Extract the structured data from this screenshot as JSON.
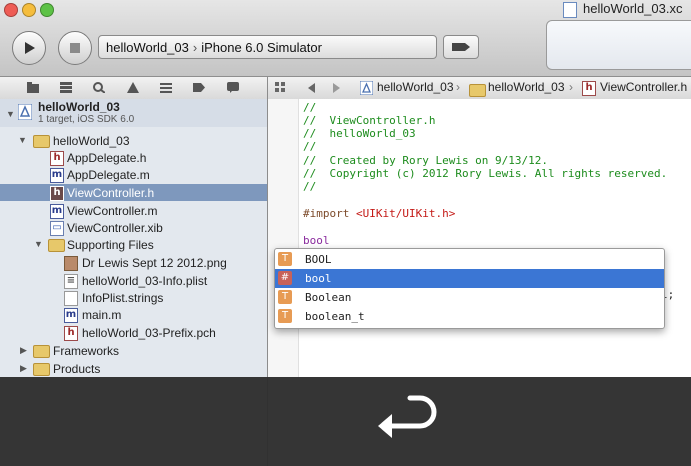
{
  "window": {
    "title": "helloWorld_03.xc"
  },
  "toolbar": {
    "scheme_project": "helloWorld_03",
    "scheme_separator": "›",
    "scheme_destination": "iPhone 6.0 Simulator"
  },
  "project": {
    "name": "helloWorld_03",
    "subtitle": "1 target, iOS SDK 6.0"
  },
  "navigator": {
    "items": [
      {
        "label": "helloWorld_03"
      },
      {
        "label": "AppDelegate.h"
      },
      {
        "label": "AppDelegate.m"
      },
      {
        "label": "ViewController.h"
      },
      {
        "label": "ViewController.m"
      },
      {
        "label": "ViewController.xib"
      },
      {
        "label": "Supporting Files"
      },
      {
        "label": "Dr Lewis Sept 12 2012.png"
      },
      {
        "label": "helloWorld_03-Info.plist"
      },
      {
        "label": "InfoPlist.strings"
      },
      {
        "label": "main.m"
      },
      {
        "label": "helloWorld_03-Prefix.pch"
      },
      {
        "label": "Frameworks"
      },
      {
        "label": "Products"
      }
    ]
  },
  "jump_bar": {
    "crumb1": "helloWorld_03",
    "crumb2": "helloWorld_03",
    "crumb3": "ViewController.h"
  },
  "editor": {
    "lines": [
      "//",
      "//  ViewController.h",
      "//  helloWorld_03",
      "//",
      "//  Created by Rory Lewis on 9/13/12.",
      "//  Copyright (c) 2012 Rory Lewis. All rights reserved.",
      "//"
    ],
    "import_keyword": "#import ",
    "import_target": "<UIKit/UIKit.h>",
    "typed_text": "bool",
    "hidden_suffix": "l;"
  },
  "completion": {
    "items": [
      {
        "kind": "T",
        "label": "BOOL"
      },
      {
        "kind": "#",
        "label": "bool"
      },
      {
        "kind": "T",
        "label": "Boolean"
      },
      {
        "kind": "T",
        "label": "boolean_t"
      }
    ],
    "selected_index": 1
  },
  "colors": {
    "selection": "#7e98bd",
    "completion_selection": "#3b76d4",
    "comment": "#1d8c1d"
  }
}
